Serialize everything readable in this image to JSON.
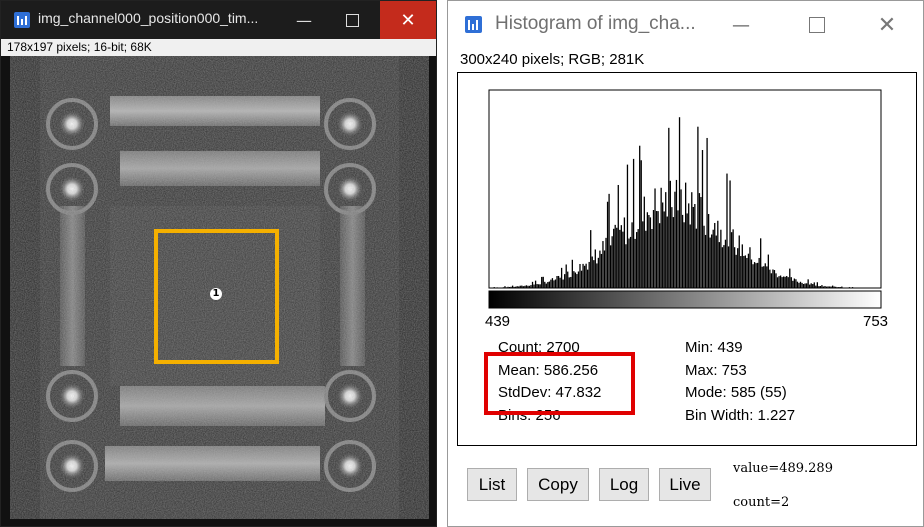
{
  "image_window": {
    "title": "img_channel000_position000_tim...",
    "info": "178x197 pixels; 16-bit; 68K",
    "roi_label": "1",
    "controls": {
      "minimize": "—",
      "close": "✕"
    }
  },
  "histogram_window": {
    "title": "Histogram of img_cha...",
    "info": "300x240 pixels; RGB; 281K",
    "controls": {
      "minimize": "—",
      "close": "✕"
    },
    "axis_min": "439",
    "axis_max": "753",
    "stats_left": {
      "count": "Count: 2700",
      "mean": "Mean: 586.256",
      "stddev": "StdDev: 47.832",
      "bins": "Bins: 256"
    },
    "stats_right": {
      "min": "Min: 439",
      "max": "Max: 753",
      "mode": "Mode: 585 (55)",
      "bin_width": "Bin Width: 1.227"
    },
    "buttons": {
      "list": "List",
      "copy": "Copy",
      "log": "Log",
      "live": "Live"
    },
    "readout": {
      "value": "value=489.289",
      "count": "count=2"
    }
  },
  "colors": {
    "roi": "#f5b000",
    "highlight": "#e00000",
    "close_button": "#c42b1c",
    "app_icon": "#2f6fd6"
  }
}
